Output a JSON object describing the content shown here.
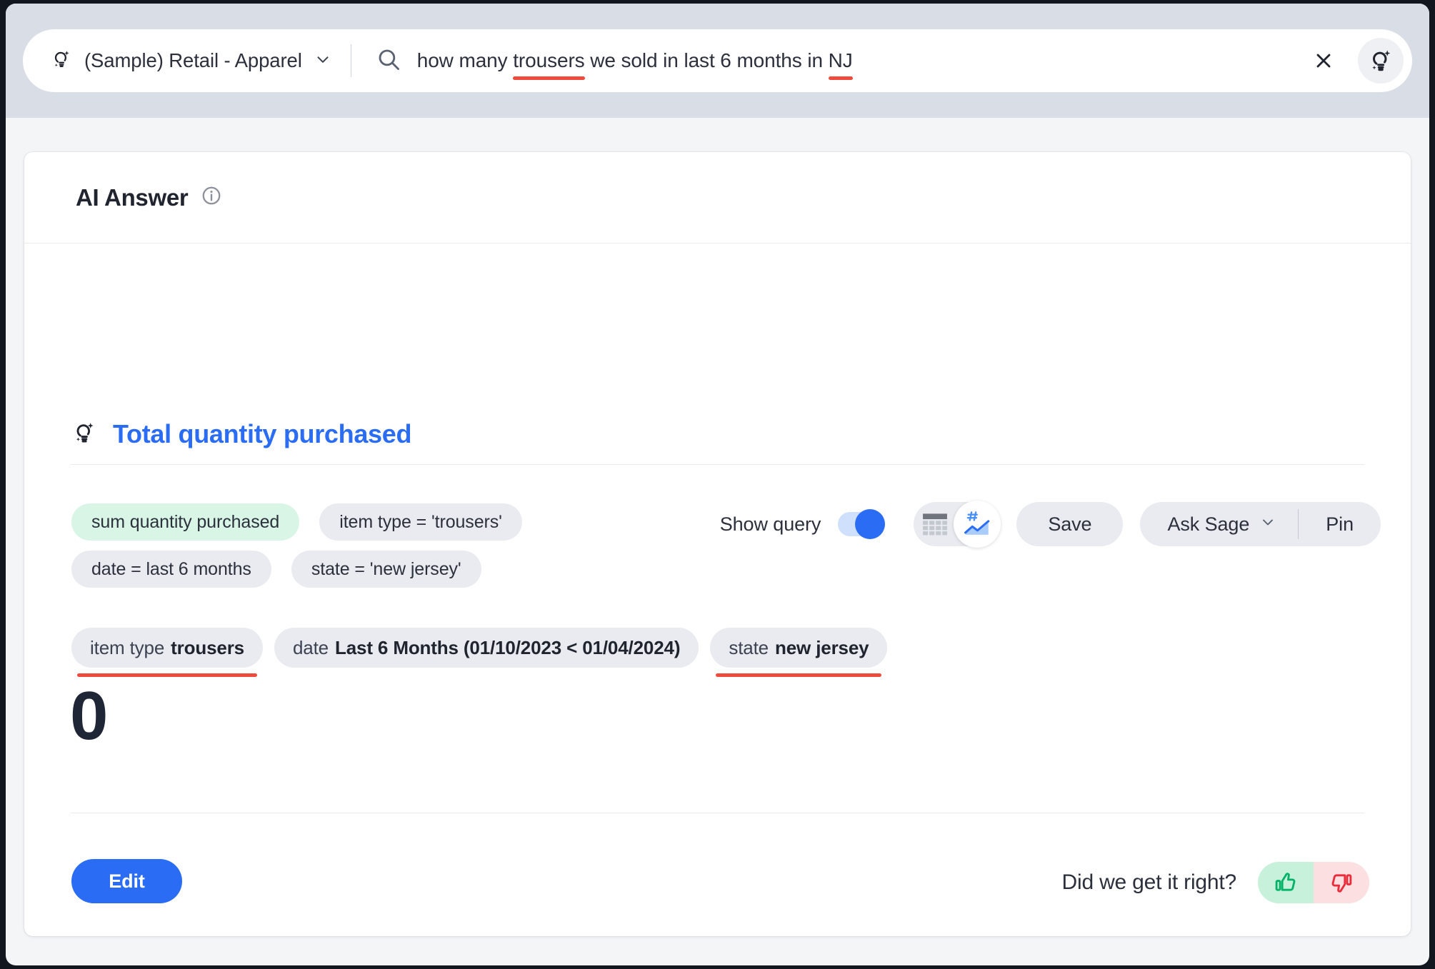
{
  "search": {
    "source_label": "(Sample) Retail - Apparel",
    "source_icon": "sage-lightbulb-icon",
    "query_prefix": "how many ",
    "query_word_1": "trousers",
    "query_middle": " we sold in last 6 months in ",
    "query_word_2": "NJ",
    "query_full": "how many trousers we sold in last 6 months in NJ",
    "clear_icon": "close-icon",
    "sage_icon": "sage-lightbulb-icon"
  },
  "card": {
    "header": {
      "title": "AI Answer",
      "info_icon": "info-icon"
    },
    "answer": {
      "icon": "sage-lightbulb-icon",
      "title": "Total quantity purchased",
      "value": "0"
    },
    "query_chips": [
      {
        "label": "sum quantity purchased",
        "kind": "measure"
      },
      {
        "label": "item type = 'trousers'",
        "kind": "filter"
      },
      {
        "label": "date = last 6 months",
        "kind": "filter"
      },
      {
        "label": "state = 'new jersey'",
        "kind": "filter"
      }
    ],
    "toolbar": {
      "show_query_label": "Show query",
      "show_query_on": true,
      "table_view_icon": "table-icon",
      "chart_view_icon": "chart-icon",
      "chart_view_selected": true,
      "save_label": "Save",
      "ask_sage_label": "Ask Sage",
      "ask_sage_chevron": "chevron-down-icon",
      "pin_label": "Pin"
    },
    "filter_chips": [
      {
        "key": "item type",
        "value": "trousers",
        "error": true
      },
      {
        "key": "date",
        "value": "Last 6 Months (01/10/2023 < 01/04/2024)",
        "error": false
      },
      {
        "key": "state",
        "value": "new jersey",
        "error": true
      }
    ],
    "footer": {
      "edit_label": "Edit",
      "feedback_label": "Did we get it right?",
      "thumbs_up_icon": "thumbs-up-icon",
      "thumbs_down_icon": "thumbs-down-icon"
    }
  },
  "colors": {
    "accent_blue": "#2a6df4",
    "error_red": "#ee4b3c",
    "measure_green": "#d9f5e5",
    "chip_gray": "#e9ebf0",
    "thumbs_up_green": "#00b368",
    "thumbs_down_red": "#ec2b3b",
    "header_band": "#d9dde6",
    "page_bg": "#f4f5f7"
  }
}
